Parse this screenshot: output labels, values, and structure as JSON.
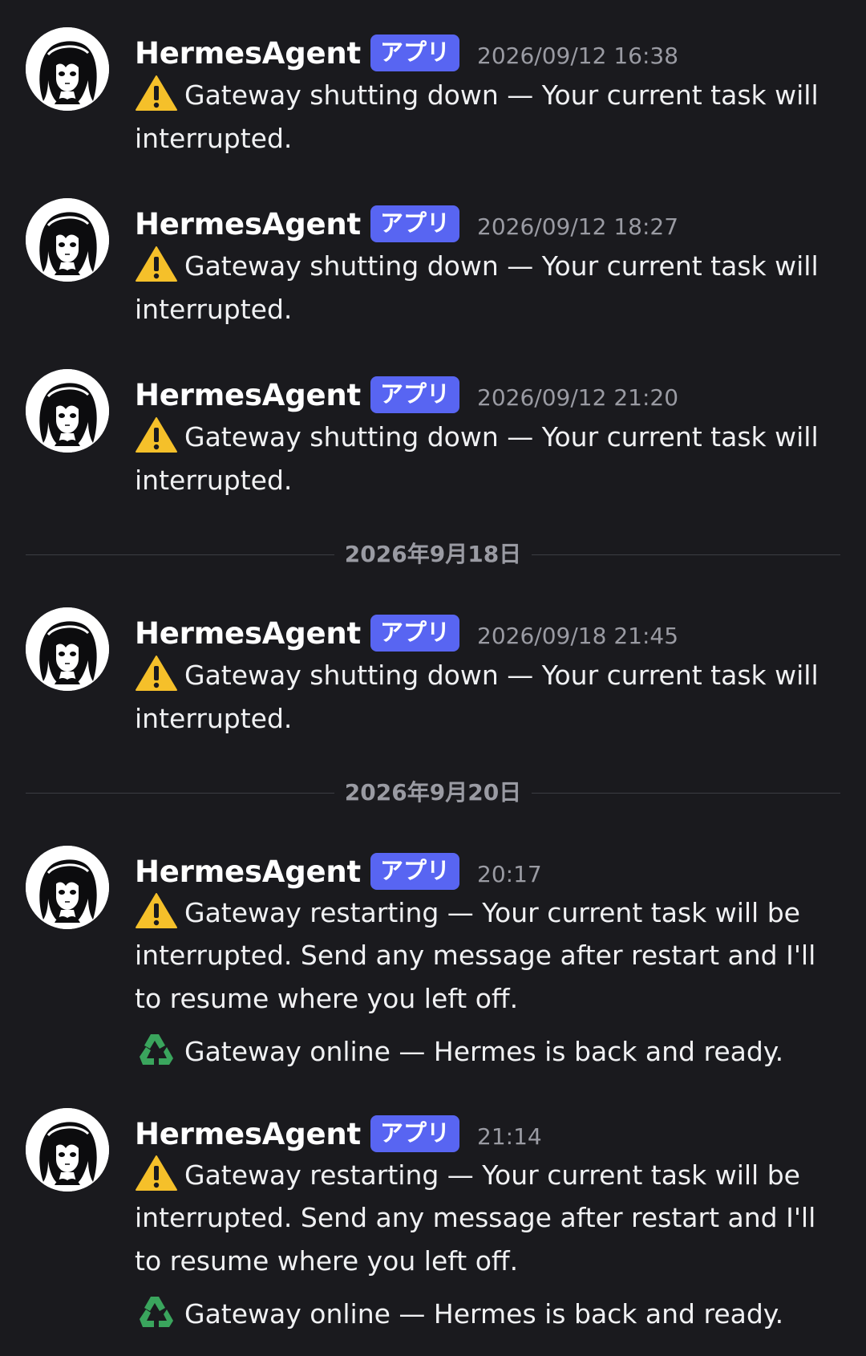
{
  "messages": [
    {
      "username": "HermesAgent",
      "badge": "アプリ",
      "timestamp": "2026/09/12 16:38",
      "lines": [
        "Gateway shutting down — Your current task will be",
        "interrupted."
      ]
    },
    {
      "username": "HermesAgent",
      "badge": "アプリ",
      "timestamp": "2026/09/12 18:27",
      "lines": [
        "Gateway shutting down — Your current task will be",
        "interrupted."
      ]
    },
    {
      "username": "HermesAgent",
      "badge": "アプリ",
      "timestamp": "2026/09/12 21:20",
      "lines": [
        "Gateway shutting down — Your current task will be",
        "interrupted."
      ]
    },
    {
      "username": "HermesAgent",
      "badge": "アプリ",
      "timestamp": "2026/09/18 21:45",
      "lines": [
        "Gateway shutting down — Your current task will be",
        "interrupted."
      ]
    },
    {
      "username": "HermesAgent",
      "badge": "アプリ",
      "timestamp": "20:17",
      "lines": [
        "Gateway restarting — Your current task will be",
        "interrupted. Send any message after restart and I'll try",
        "to resume where you left off."
      ],
      "online": "Gateway online — Hermes is back and ready."
    },
    {
      "username": "HermesAgent",
      "badge": "アプリ",
      "timestamp": "21:14",
      "lines": [
        "Gateway restarting — Your current task will be",
        "interrupted. Send any message after restart and I'll try",
        "to resume where you left off."
      ],
      "online": "Gateway online — Hermes is back and ready."
    }
  ],
  "dividers": [
    "2026年9月18日",
    "2026年9月20日"
  ],
  "icons": {
    "warning": "warning-icon",
    "recycle": "recycle-icon",
    "avatar": "avatar"
  },
  "colors": {
    "background": "#1a1a1e",
    "badge": "#5865f2",
    "timestamp": "#9a9ba3",
    "warning": "#f5c02a",
    "recycle": "#3aa55d"
  }
}
